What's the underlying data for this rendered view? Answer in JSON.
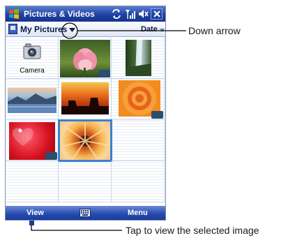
{
  "window": {
    "title": "Pictures & Videos",
    "icons": [
      "windows-start-icon",
      "sync-icon",
      "signal-icon",
      "speaker-icon",
      "close-icon"
    ]
  },
  "folderbar": {
    "folder_label": "My Pictures",
    "sort_label": "Date"
  },
  "grid": {
    "items": [
      {
        "name": "Camera",
        "kind": "camera",
        "label": "Camera"
      },
      {
        "name": "lotus",
        "kind": "video"
      },
      {
        "name": "waterfall",
        "kind": "image"
      },
      {
        "name": "mountain-lake",
        "kind": "image"
      },
      {
        "name": "desert-sunset",
        "kind": "image"
      },
      {
        "name": "orange-rings",
        "kind": "video"
      },
      {
        "name": "red-hearts",
        "kind": "video"
      },
      {
        "name": "sunflower",
        "kind": "image",
        "selected": true
      }
    ]
  },
  "softkeys": {
    "left": "View",
    "right": "Menu",
    "center_icon": "keyboard-icon"
  },
  "callouts": {
    "down_arrow": "Down arrow",
    "tap_view": "Tap to view the selected image"
  },
  "colors": {
    "titlebar": "#1f40a3",
    "selection": "#3d7fd2",
    "softbar": "#264bb0"
  }
}
